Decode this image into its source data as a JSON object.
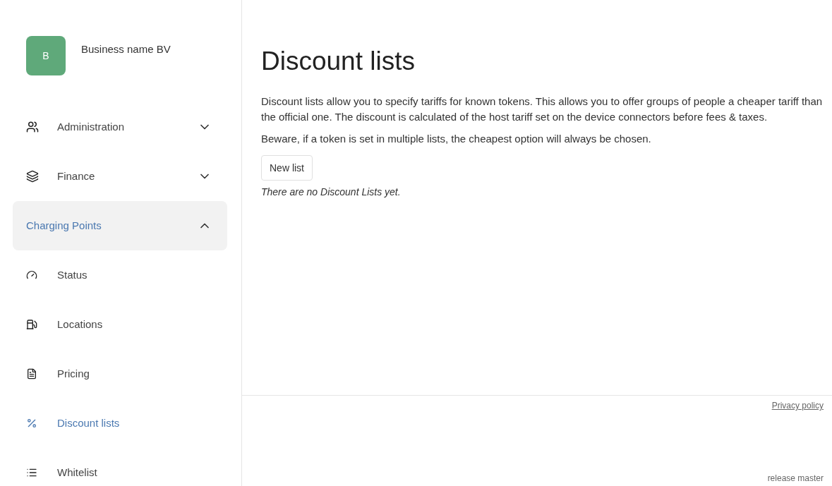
{
  "business": {
    "initial": "B",
    "name": "Business name BV"
  },
  "nav": [
    {
      "label": "Administration",
      "expanded": false
    },
    {
      "label": "Finance",
      "expanded": false
    },
    {
      "label": "Charging Points",
      "expanded": true,
      "children": [
        {
          "label": "Status",
          "selected": false
        },
        {
          "label": "Locations",
          "selected": false
        },
        {
          "label": "Pricing",
          "selected": false
        },
        {
          "label": "Discount lists",
          "selected": true
        },
        {
          "label": "Whitelist",
          "selected": false
        }
      ]
    }
  ],
  "main": {
    "title": "Discount lists",
    "paragraphs": [
      "Discount lists allow you to specify tariffs for known tokens. This allows you to offer groups of people a cheaper tariff than the official one. The discount is calculated of the host tariff set on the device connectors before fees & taxes.",
      "Beware, if a token is set in multiple lists, the cheapest option will always be chosen."
    ],
    "button": "New list",
    "empty_note": "There are no Discount Lists yet."
  },
  "footer": {
    "link": "Privacy policy",
    "release": "release master"
  }
}
